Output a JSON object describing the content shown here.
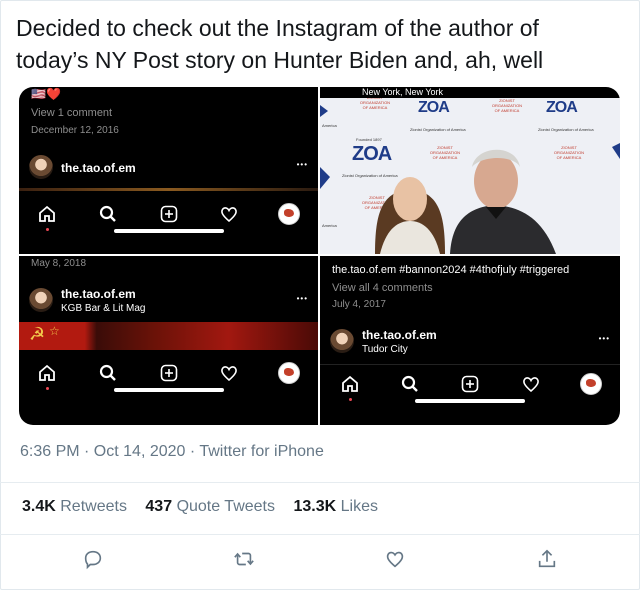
{
  "tweet": {
    "text": "Decided to check out the Instagram of the author of today’s NY Post story on Hunter Biden and, ah, well",
    "time": "6:36 PM · Oct 14, 2020 · Twitter for iPhone",
    "retweets_count": "3.4K",
    "retweets_label": "Retweets",
    "quotes_count": "437",
    "quotes_label": "Quote Tweets",
    "likes_count": "13.3K",
    "likes_label": "Likes"
  },
  "panes": {
    "p1": {
      "flags": "🇺🇸❤️",
      "comments": "View 1 comment",
      "date": "December 12, 2016",
      "username": "the.tao.of.em"
    },
    "p2": {
      "location": "New York, New York",
      "zoa": "ZOA",
      "zoa_sub": "Zionist Organization of America",
      "zoa_red": "ZIONIST ORGANIZATION OF AMERICA",
      "founded": "Founded 1897",
      "america": "America"
    },
    "p3": {
      "date": "May 8, 2018",
      "username": "the.tao.of.em",
      "location": "KGB Bar & Lit Mag"
    },
    "p4": {
      "caption": "the.tao.of.em #bannon2024 #4thofjuly #triggered",
      "comments": "View all 4 comments",
      "date": "July 4, 2017",
      "username": "the.tao.of.em",
      "location": "Tudor City"
    }
  },
  "dots": "•••",
  "colors": {
    "instagram_bg": "#000000",
    "muted": "#657786",
    "notification": "#ed4956"
  }
}
